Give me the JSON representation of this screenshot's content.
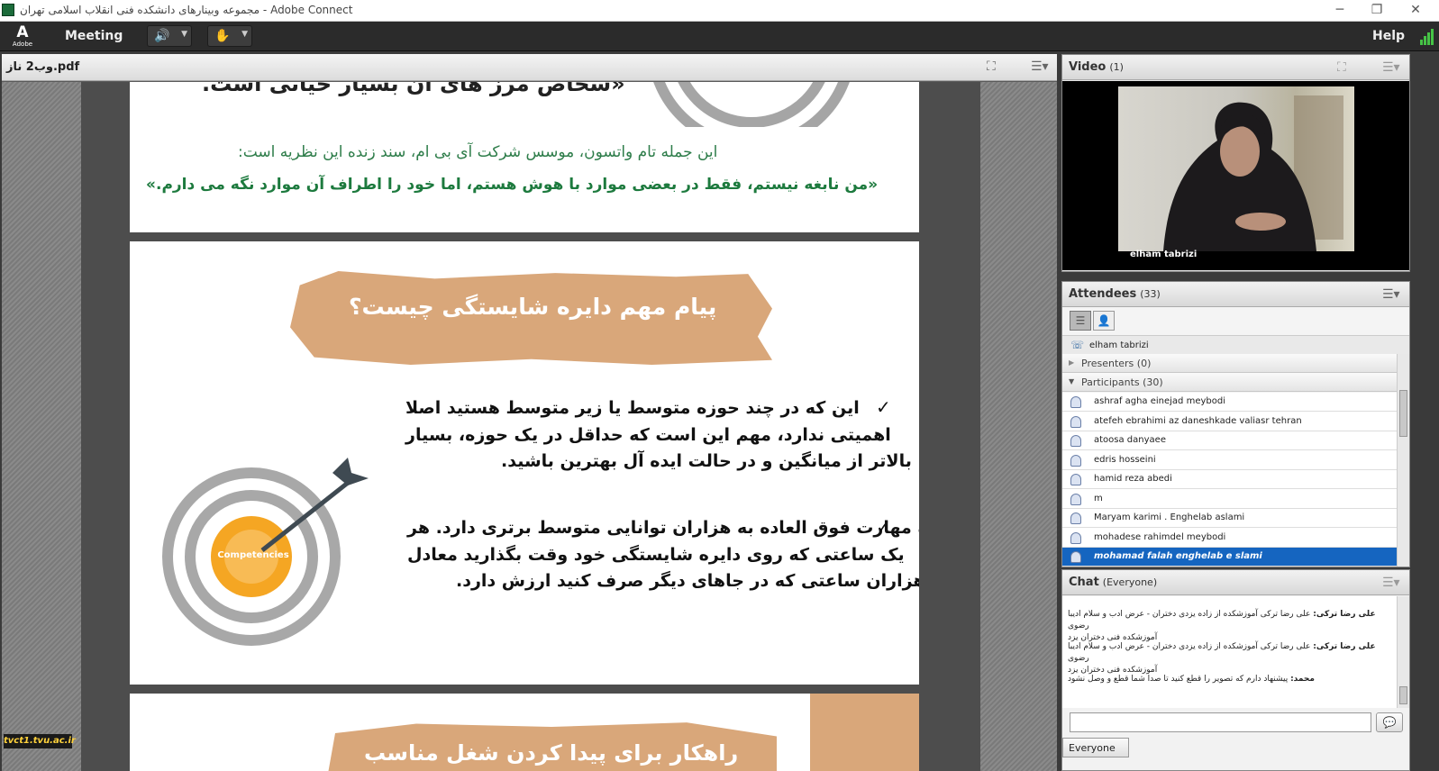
{
  "window": {
    "title": "مجموعه وبینارهای دانشکده فنی انقلاب اسلامی تهران - Adobe Connect",
    "minimize": "─",
    "restore": "❐",
    "close": "✕"
  },
  "menubar": {
    "logo": "A",
    "logo_sub": "Adobe",
    "meeting": "Meeting",
    "help": "Help"
  },
  "share": {
    "filename": "وب2 ناز.pdf",
    "slide1": {
      "heading_fragment": "«سخاص مرز های آن بسیار حیاتی است.",
      "line1": "این جمله تام واتسون، موسس شرکت آی بی ام، سند زنده این نظریه است:",
      "quote": "«من نابغه نیستم، فقط در بعضی موارد با هوش هستم، اما خود را اطراف آن موارد نگه می دارم.»"
    },
    "slide2": {
      "title": "پیام مهم دایره شایستگی چیست؟",
      "bullet1": [
        "این که در چند حوزه متوسط  یا زیر متوسط هستید اصلا",
        "اهمیتی ندارد، مهم این است که حداقل در یک حوزه، بسیار",
        "بالاتر از میانگین و در حالت ایده آل بهترین باشید."
      ],
      "bullet2": [
        "یک مهارت فوق العاده به هزاران توانایی متوسط برتری دارد. هر",
        "یک ساعتی که روی دایره شایستگی خود وقت بگذارید معادل",
        "هزاران ساعتی که در جاهای دیگر صرف کنید ارزش دارد."
      ],
      "target_label": "Competencies",
      "check": "✓"
    },
    "slide3": {
      "title_fragment": "راهکار برای پیدا کردن شغل مناسب"
    }
  },
  "watermark": "tvct1.tvu.ac.ir",
  "video": {
    "title": "Video",
    "count": "(1)",
    "name": "elham tabrizi"
  },
  "attendees": {
    "title": "Attendees",
    "count": "(33)",
    "host": "elham tabrizi",
    "presenters": "Presenters (0)",
    "participants": "Participants (30)",
    "list": [
      "ashraf agha einejad meybodi",
      "atefeh ebrahimi az daneshkade valiasr tehran",
      "atoosa danyaee",
      "edris hosseini",
      "hamid reza abedi",
      "m",
      "Maryam karimi   . Enghelab aslami",
      "mohadese rahimdel meybodi",
      "mohamad falah    enghelab e slami"
    ]
  },
  "chat": {
    "title": "Chat",
    "scope": "(Everyone)",
    "messages": [
      {
        "sender": "علی رضا ترکی:",
        "text": "علی رضا ترکی آموزشکده از زاده یزدی دختران - عرض ادب و سلام ادیبا رضوی",
        "extra": "آموزشکده فنی دختران یزد"
      },
      {
        "sender": "علی رضا ترکی:",
        "text": "علی رضا ترکی آموزشکده از زاده یزدی دختران - عرض ادب و سلام ادیبا رضوی",
        "extra": "آموزشکده فنی دختران یزد"
      },
      {
        "sender": "محمد:",
        "text": "پیشنهاد دارم که تصویر را قطع کنید تا صدا شما قطع و وصل نشود"
      }
    ],
    "input_placeholder": "",
    "recipient": "Everyone"
  }
}
